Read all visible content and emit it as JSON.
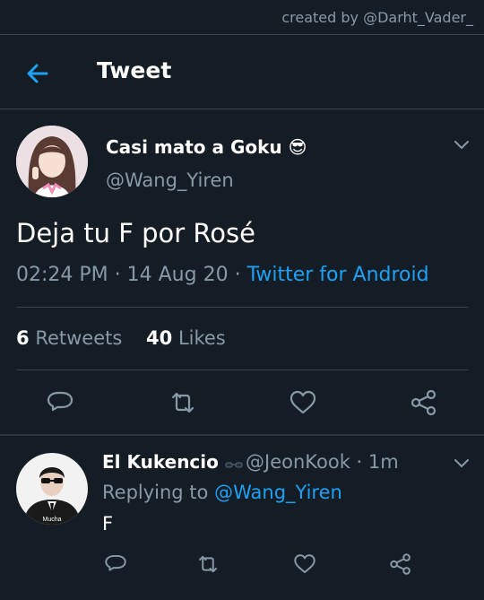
{
  "credit": "created by @Darht_Vader_",
  "header": {
    "title": "Tweet"
  },
  "tweet": {
    "display_name": "Casi mato a Goku",
    "name_emoji": "😎",
    "handle": "@Wang_Yiren",
    "text": "Deja tu F por Rosé",
    "time": "02:24 PM",
    "date": "14 Aug 20",
    "source": "Twitter for Android",
    "retweets_count": "6",
    "retweets_label": "Retweets",
    "likes_count": "40",
    "likes_label": "Likes"
  },
  "reply": {
    "display_name": "El Kukencio",
    "handle": "@JeonKook",
    "age": "1m",
    "replying_prefix": "Replying to",
    "replying_to": "@Wang_Yiren",
    "text": "F",
    "avatar_caption": "Mucha"
  },
  "colors": {
    "background": "#141d26",
    "accent": "#1da1f2",
    "muted": "#8899a6",
    "divider": "#38444d"
  },
  "icons": [
    "back-arrow-icon",
    "chevron-down-icon",
    "reply-icon",
    "retweet-icon",
    "like-icon",
    "share-icon"
  ]
}
